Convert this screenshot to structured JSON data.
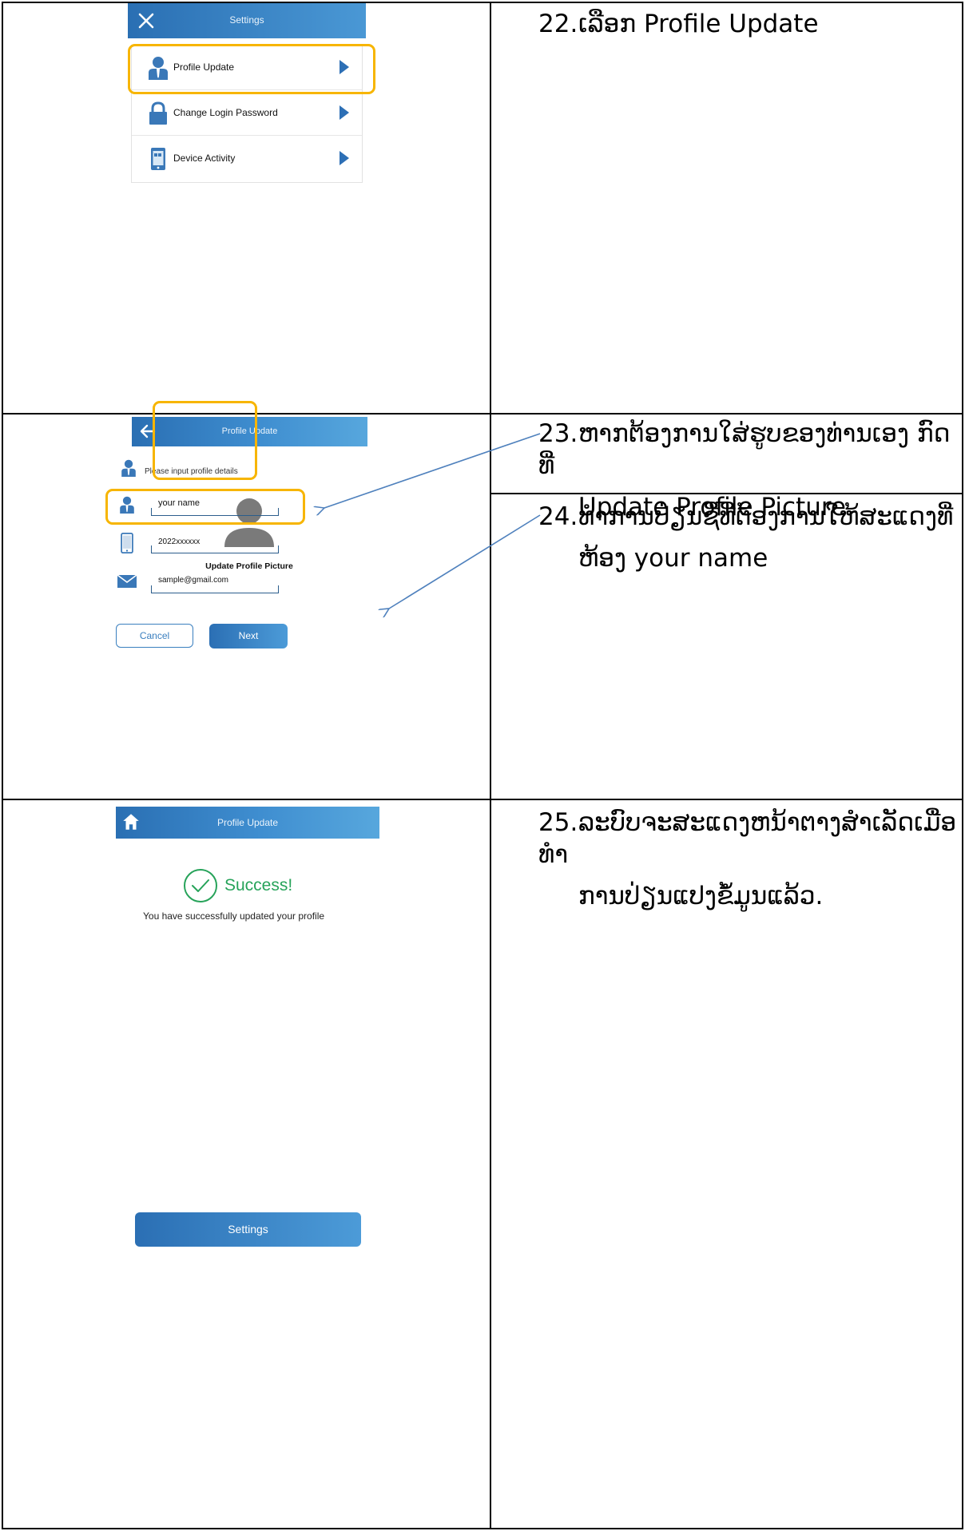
{
  "steps": {
    "s22": {
      "num": "22.",
      "text": "ເລືອກ Profile Update"
    },
    "s23": {
      "num": "23.",
      "text": "ຫາກຕ້ອງການໃສ່ຮູບຂອງທ່ານເອງ ກົດທີ່",
      "text2": "Update Profile Picture"
    },
    "s24": {
      "num": "24.",
      "text": "ທຳການປ່ຽນຊື່ທີ່ຕ້ອງການໃຫ້ສະແດງທີ່",
      "text2": "ຫ້ອງ your name"
    },
    "s25": {
      "num": "25.",
      "text": "ລະບົບຈະສະແດງຫນ້າຕາງສຳເລັດເມື່ອ ທຳ",
      "text2": "ການປ່ຽນແປງຂໍ້ມູນແລ້ວ."
    }
  },
  "settings_screen": {
    "title": "Settings",
    "items": [
      {
        "label": "Profile Update"
      },
      {
        "label": "Change Login Password"
      },
      {
        "label": "Device Activity"
      }
    ]
  },
  "profile_screen": {
    "title": "Profile Update",
    "instruction": "Please input profile details",
    "picture_label": "Update Profile Picture",
    "name_value": "your name",
    "phone_value": "2022xxxxxx",
    "email_value": "sample@gmail.com",
    "cancel_label": "Cancel",
    "next_label": "Next"
  },
  "success_screen": {
    "title": "Profile Update",
    "heading": "Success!",
    "message": "You have successfully updated your profile",
    "settings_button": "Settings"
  },
  "colors": {
    "appbar": "#3f8ed0",
    "highlight": "#f7b500",
    "success": "#27a35a",
    "arrow": "#4f81bd"
  },
  "icons": [
    "close-icon",
    "back-arrow-icon",
    "home-icon",
    "user-icon",
    "lock-icon",
    "device-icon",
    "phone-icon",
    "mail-icon",
    "check-circle-icon",
    "chevron-right-icon"
  ]
}
